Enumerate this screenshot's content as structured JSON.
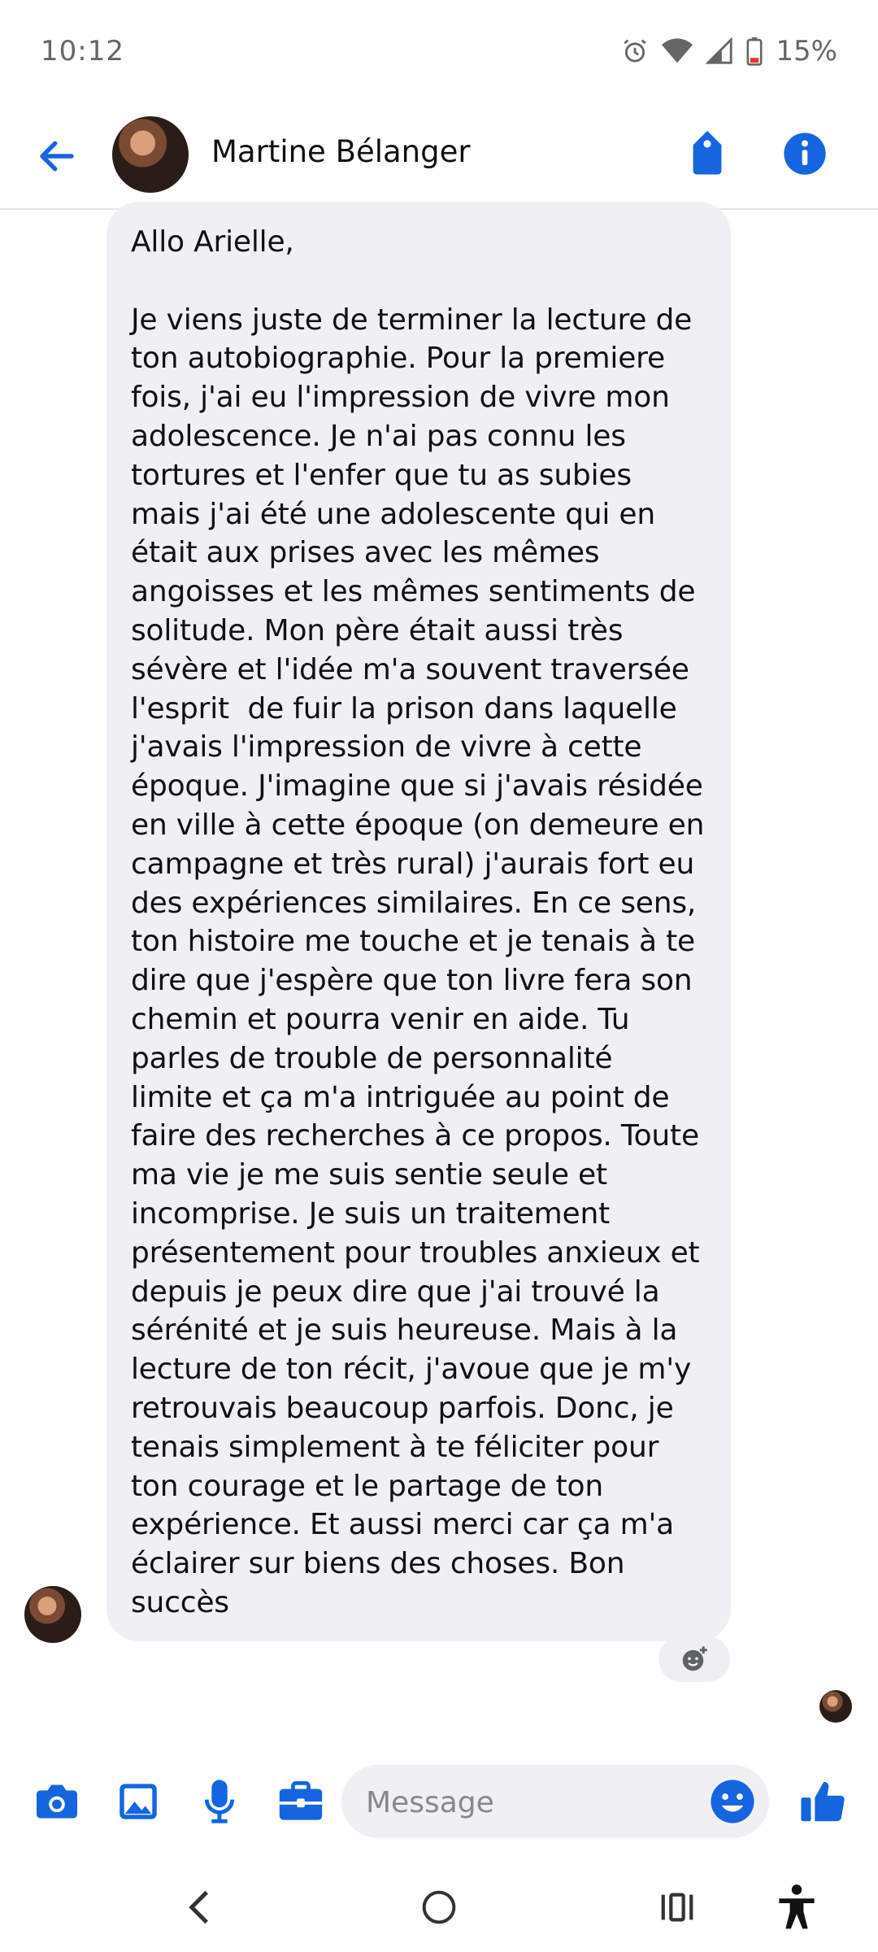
{
  "status_bar": {
    "time": "10:12",
    "battery": "15%"
  },
  "header": {
    "contact_name": "Martine Bélanger"
  },
  "message": {
    "text": "Allo Arielle,\n\nJe viens juste de terminer la lecture de\nton autobiographie. Pour la premiere\nfois, j'ai eu l'impression de vivre mon\nadolescence. Je n'ai pas connu les\ntortures et l'enfer que tu as subies\nmais j'ai été une adolescente qui en\nétait aux prises avec les mêmes\nangoisses et les mêmes sentiments de\nsolitude. Mon père était aussi très\nsévère et l'idée m'a souvent traversée\nl'esprit  de fuir la prison dans laquelle\nj'avais l'impression de vivre à cette\népoque. J'imagine que si j'avais résidée\nen ville à cette époque (on demeure en\ncampagne et très rural) j'aurais fort eu\ndes expériences similaires. En ce sens,\nton histoire me touche et je tenais à te\ndire que j'espère que ton livre fera son\nchemin et pourra venir en aide. Tu\nparles de trouble de personnalité\nlimite et ça m'a intriguée au point de\nfaire des recherches à ce propos. Toute\nma vie je me suis sentie seule et\nincomprise. Je suis un traitement\nprésentement pour troubles anxieux et\ndepuis je peux dire que j'ai trouvé la\nsérénité et je suis heureuse. Mais à la\nlecture de ton récit, j'avoue que je m'y\nretrouvais beaucoup parfois. Donc, je\ntenais simplement à te féliciter pour\nton courage et le partage de ton\nexpérience. Et aussi merci car ça m'a\néclairer sur biens des choses. Bon\nsuccès"
  },
  "composer": {
    "placeholder": "Message"
  },
  "colors": {
    "accent": "#1565e0",
    "bubble": "#f0f0f4"
  },
  "icons": {
    "back": "arrow-left-icon",
    "tag": "tag-icon",
    "info": "info-icon",
    "camera": "camera-icon",
    "gallery": "image-icon",
    "mic": "microphone-icon",
    "briefcase": "briefcase-icon",
    "emoji": "emoji-icon",
    "like": "thumbs-up-icon"
  }
}
